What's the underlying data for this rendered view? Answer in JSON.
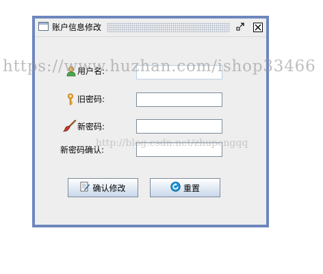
{
  "window": {
    "title": "账户信息修改",
    "restore_icon": "restore-icon",
    "close_icon": "close-icon",
    "border_color": "#6d86bd"
  },
  "form": {
    "username": {
      "label": "用户名:",
      "value": "",
      "icon": "user-icon"
    },
    "old_password": {
      "label": "旧密码:",
      "value": "",
      "icon": "key-icon"
    },
    "new_password": {
      "label": "新密码:",
      "value": "",
      "icon": "brush-icon"
    },
    "confirm_password": {
      "label": "新密码确认:",
      "value": ""
    }
  },
  "buttons": {
    "confirm_label": "确认修改",
    "reset_label": "重置"
  },
  "watermarks": {
    "primary": "https://www.huzhan.com/ishop33466",
    "secondary": "http://blog.csdn.net/zhupengqq"
  }
}
